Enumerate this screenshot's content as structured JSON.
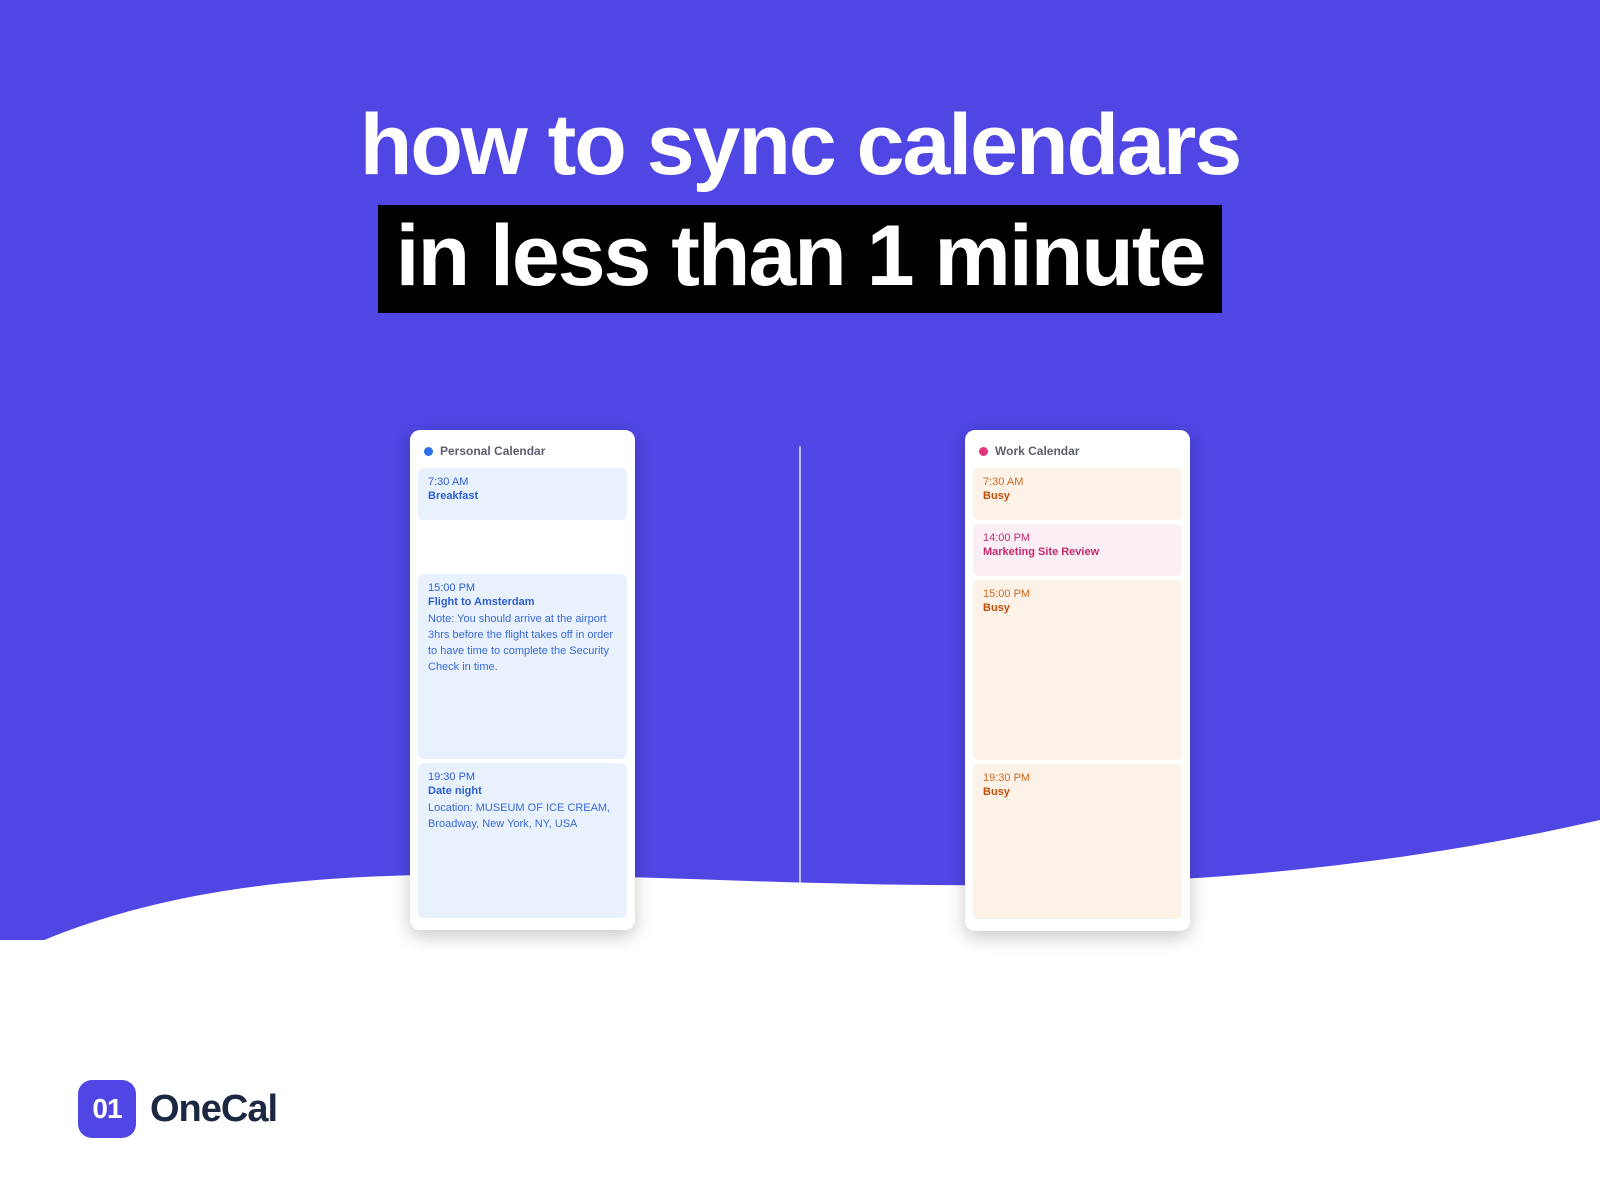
{
  "headline": {
    "line1": "how to sync calendars",
    "line2": "in less than 1 minute"
  },
  "personal": {
    "title": "Personal Calendar",
    "events": [
      {
        "time": "7:30 AM",
        "title": "Breakfast",
        "desc": ""
      },
      {
        "time": "15:00 PM",
        "title": "Flight to Amsterdam",
        "desc": "Note: You should arrive at the airport 3hrs before the flight takes off in order to have time to complete the Security Check in time."
      },
      {
        "time": "19:30 PM",
        "title": "Date night",
        "desc": "Location: MUSEUM OF ICE CREAM, Broadway, New York, NY, USA"
      }
    ]
  },
  "work": {
    "title": "Work Calendar",
    "events": [
      {
        "time": "7:30 AM",
        "title": "Busy",
        "style": "orange"
      },
      {
        "time": "14:00 PM",
        "title": "Marketing Site Review",
        "style": "pink"
      },
      {
        "time": "15:00 PM",
        "title": "Busy",
        "style": "orange"
      },
      {
        "time": "19:30 PM",
        "title": "Busy",
        "style": "orange"
      }
    ]
  },
  "brand": {
    "icon": "01",
    "name": "OneCal"
  }
}
